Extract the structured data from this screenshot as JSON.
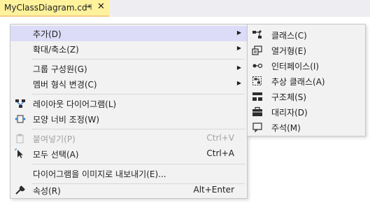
{
  "tab": {
    "title": "MyClassDiagram.cd*",
    "pin": "⊣",
    "close": "✕"
  },
  "menu": {
    "items": [
      {
        "label": "추가(D)",
        "shortcut": "",
        "submenu": true
      },
      {
        "label": "확대/축소(Z)",
        "shortcut": "",
        "submenu": true
      },
      {
        "label": "그룹 구성원(G)",
        "shortcut": "",
        "submenu": true
      },
      {
        "label": "멤버 형식 변경(C)",
        "shortcut": "",
        "submenu": true
      },
      {
        "label": "레이아웃 다이어그램(L)",
        "shortcut": ""
      },
      {
        "label": "모양 너비 조정(W)",
        "shortcut": ""
      },
      {
        "label": "붙여넣기(P)",
        "shortcut": "Ctrl+V",
        "disabled": true
      },
      {
        "label": "모두 선택(A)",
        "shortcut": "Ctrl+A"
      },
      {
        "label": "다이어그램을 이미지로 내보내기(E)...",
        "shortcut": ""
      },
      {
        "label": "속성(R)",
        "shortcut": "Alt+Enter"
      }
    ],
    "arrow": "▶"
  },
  "submenu": {
    "items": [
      {
        "label": "클래스(C)",
        "icon": "class-icon"
      },
      {
        "label": "열거형(E)",
        "icon": "enum-icon"
      },
      {
        "label": "인터페이스(I)",
        "icon": "interface-icon"
      },
      {
        "label": "추상 클래스(A)",
        "icon": "abstract-class-icon"
      },
      {
        "label": "구조체(S)",
        "icon": "struct-icon"
      },
      {
        "label": "대리자(D)",
        "icon": "delegate-icon"
      },
      {
        "label": "주석(M)",
        "icon": "comment-icon"
      }
    ]
  },
  "colors": {
    "tab_bg": "#fff29d",
    "menu_bg": "#f2f2f2",
    "hover": "#dcdcf8",
    "icon_blue": "#1e7bd4"
  }
}
